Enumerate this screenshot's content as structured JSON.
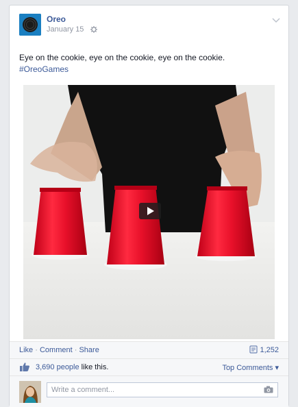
{
  "post": {
    "author": "Oreo",
    "date": "January 15",
    "text": "Eye on the cookie, eye on the cookie, eye on the cookie.",
    "hashtag": "#OreoGames"
  },
  "actions": {
    "like": "Like",
    "comment": "Comment",
    "share": "Share",
    "shares_count": "1,252"
  },
  "likes": {
    "count": "3,690 people",
    "suffix": " like this.",
    "top_comments": "Top Comments ▾"
  },
  "comment": {
    "placeholder": "Write a comment..."
  },
  "colors": {
    "link": "#3b5998",
    "brand": "#1a7fc1",
    "cup": "#e8102a"
  }
}
